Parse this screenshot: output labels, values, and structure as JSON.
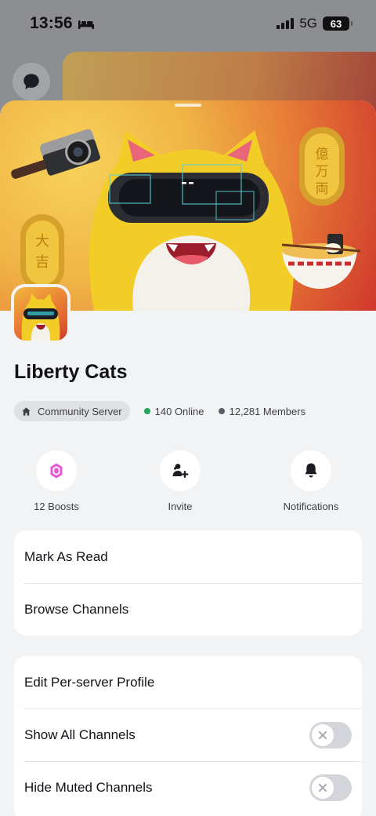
{
  "status_bar": {
    "time": "13:56",
    "network": "5G",
    "battery": "63"
  },
  "server": {
    "name": "Liberty Cats",
    "type_label": "Community Server",
    "online": "140 Online",
    "members": "12,281 Members"
  },
  "actions": [
    {
      "label": "12 Boosts",
      "icon": "boost-gem-icon"
    },
    {
      "label": "Invite",
      "icon": "add-person-icon"
    },
    {
      "label": "Notifications",
      "icon": "bell-icon"
    }
  ],
  "card1": {
    "mark_as_read": "Mark As Read",
    "browse_channels": "Browse Channels"
  },
  "card2": {
    "edit_profile": "Edit Per-server Profile",
    "show_all_channels": "Show All Channels",
    "hide_muted_channels": "Hide Muted Channels",
    "show_all_channels_on": false,
    "hide_muted_channels_on": false
  },
  "colors": {
    "online_dot": "#23a55a",
    "members_dot": "#5c5e66",
    "boost": "#e45bd4",
    "sheet_bg": "#f2f3f5"
  }
}
